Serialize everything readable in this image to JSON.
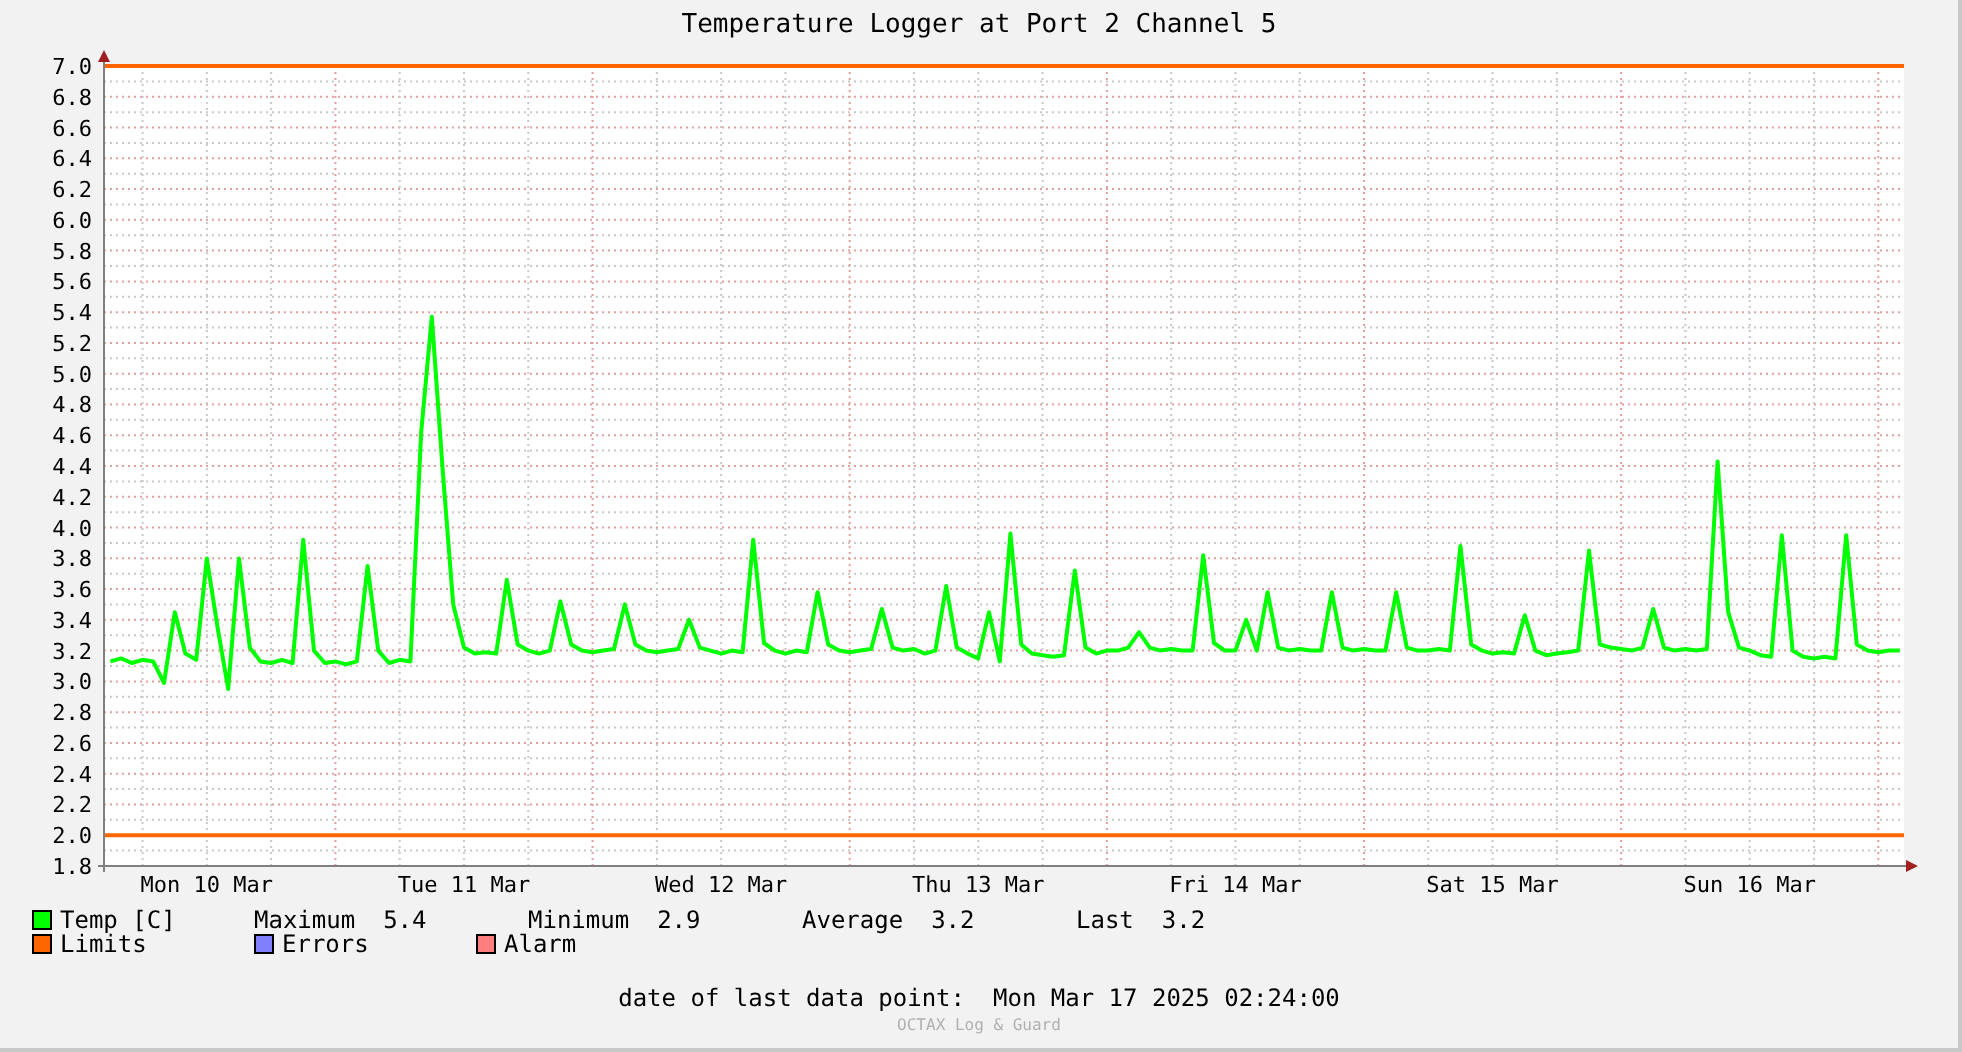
{
  "chart_data": {
    "type": "line",
    "title": "Temperature Logger at Port 2 Channel 5",
    "ylim": [
      1.8,
      7.0
    ],
    "yticks": [
      {
        "value": 1.8,
        "label": "1.8"
      },
      {
        "value": 2.0,
        "label": "2.0"
      },
      {
        "value": 2.2,
        "label": "2.2"
      },
      {
        "value": 2.4,
        "label": "2.4"
      },
      {
        "value": 2.6,
        "label": "2.6"
      },
      {
        "value": 2.8,
        "label": "2.8"
      },
      {
        "value": 3.0,
        "label": "3.0"
      },
      {
        "value": 3.2,
        "label": "3.2"
      },
      {
        "value": 3.4,
        "label": "3.4"
      },
      {
        "value": 3.6,
        "label": "3.6"
      },
      {
        "value": 3.8,
        "label": "3.8"
      },
      {
        "value": 4.0,
        "label": "4.0"
      },
      {
        "value": 4.2,
        "label": "4.2"
      },
      {
        "value": 4.4,
        "label": "4.4"
      },
      {
        "value": 4.6,
        "label": "4.6"
      },
      {
        "value": 4.8,
        "label": "4.8"
      },
      {
        "value": 5.0,
        "label": "5.0"
      },
      {
        "value": 5.2,
        "label": "5.2"
      },
      {
        "value": 5.4,
        "label": "5.4"
      },
      {
        "value": 5.6,
        "label": "5.6"
      },
      {
        "value": 5.8,
        "label": "5.8"
      },
      {
        "value": 6.0,
        "label": "6.0"
      },
      {
        "value": 6.2,
        "label": "6.2"
      },
      {
        "value": 6.4,
        "label": "6.4"
      },
      {
        "value": 6.6,
        "label": "6.6"
      },
      {
        "value": 6.8,
        "label": "6.8"
      },
      {
        "value": 7.0,
        "label": "7.0"
      }
    ],
    "categories": [
      null,
      null,
      null,
      null,
      null,
      null,
      null,
      null,
      null,
      "Mon 10 Mar",
      null,
      null,
      null,
      null,
      null,
      null,
      null,
      null,
      null,
      null,
      null,
      null,
      null,
      null,
      null,
      null,
      null,
      null,
      null,
      null,
      null,
      null,
      null,
      "Tue 11 Mar",
      null,
      null,
      null,
      null,
      null,
      null,
      null,
      null,
      null,
      null,
      null,
      null,
      null,
      null,
      null,
      null,
      null,
      null,
      null,
      null,
      null,
      null,
      null,
      "Wed 12 Mar",
      null,
      null,
      null,
      null,
      null,
      null,
      null,
      null,
      null,
      null,
      null,
      null,
      null,
      null,
      null,
      null,
      null,
      null,
      null,
      null,
      null,
      null,
      null,
      "Thu 13 Mar",
      null,
      null,
      null,
      null,
      null,
      null,
      null,
      null,
      null,
      null,
      null,
      null,
      null,
      null,
      null,
      null,
      null,
      null,
      null,
      null,
      null,
      null,
      null,
      "Fri 14 Mar",
      null,
      null,
      null,
      null,
      null,
      null,
      null,
      null,
      null,
      null,
      null,
      null,
      null,
      null,
      null,
      null,
      null,
      null,
      null,
      null,
      null,
      null,
      null,
      "Sat 15 Mar",
      null,
      null,
      null,
      null,
      null,
      null,
      null,
      null,
      null,
      null,
      null,
      null,
      null,
      null,
      null,
      null,
      null,
      null,
      null,
      null,
      null,
      null,
      null,
      "Sun 16 Mar",
      null,
      null,
      null,
      null,
      null,
      null,
      null,
      null,
      null,
      null,
      null,
      null,
      null,
      null
    ],
    "series": [
      {
        "name": "Temp [C]",
        "color": "#00ff00",
        "values": [
          3.13,
          3.15,
          3.12,
          3.14,
          3.13,
          2.99,
          3.45,
          3.18,
          3.14,
          3.8,
          3.35,
          2.95,
          3.8,
          3.22,
          3.13,
          3.12,
          3.14,
          3.12,
          3.92,
          3.2,
          3.12,
          3.13,
          3.11,
          3.13,
          3.75,
          3.2,
          3.12,
          3.14,
          3.13,
          4.62,
          5.37,
          4.38,
          3.5,
          3.22,
          3.18,
          3.19,
          3.18,
          3.66,
          3.24,
          3.2,
          3.18,
          3.2,
          3.52,
          3.24,
          3.2,
          3.19,
          3.2,
          3.21,
          3.5,
          3.24,
          3.2,
          3.19,
          3.2,
          3.21,
          3.4,
          3.22,
          3.2,
          3.18,
          3.2,
          3.19,
          3.92,
          3.25,
          3.2,
          3.18,
          3.2,
          3.19,
          3.58,
          3.24,
          3.2,
          3.19,
          3.2,
          3.21,
          3.47,
          3.22,
          3.2,
          3.21,
          3.18,
          3.2,
          3.62,
          3.22,
          3.18,
          3.15,
          3.45,
          3.13,
          3.96,
          3.24,
          3.18,
          3.17,
          3.16,
          3.17,
          3.72,
          3.22,
          3.18,
          3.2,
          3.2,
          3.22,
          3.32,
          3.22,
          3.2,
          3.21,
          3.2,
          3.2,
          3.82,
          3.25,
          3.2,
          3.2,
          3.4,
          3.2,
          3.58,
          3.22,
          3.2,
          3.21,
          3.2,
          3.2,
          3.58,
          3.22,
          3.2,
          3.21,
          3.2,
          3.2,
          3.58,
          3.22,
          3.2,
          3.2,
          3.21,
          3.2,
          3.88,
          3.24,
          3.2,
          3.18,
          3.19,
          3.18,
          3.43,
          3.2,
          3.17,
          3.18,
          3.19,
          3.2,
          3.85,
          3.24,
          3.22,
          3.21,
          3.2,
          3.22,
          3.47,
          3.22,
          3.2,
          3.21,
          3.2,
          3.21,
          4.43,
          3.45,
          3.22,
          3.2,
          3.17,
          3.16,
          3.95,
          3.2,
          3.16,
          3.15,
          3.16,
          3.15,
          3.95,
          3.24,
          3.2,
          3.19,
          3.2,
          3.2
        ]
      }
    ],
    "grid": true,
    "ref_lines": [
      {
        "axis": "y",
        "value": 7.0,
        "color": "#ff6600"
      },
      {
        "axis": "y",
        "value": 2.0,
        "color": "#ff6600"
      }
    ]
  },
  "legend": [
    {
      "stats": [
        {
          "label": "Maximum",
          "value": "5.4"
        },
        {
          "label": "Minimum",
          "value": "2.9"
        },
        {
          "label": "Average",
          "value": "3.2"
        },
        {
          "label": "Last",
          "value": "3.2"
        }
      ]
    },
    {
      "entries": [
        {
          "label": "Limits",
          "color": "#ff6600"
        },
        {
          "label": "Errors",
          "color": "#7f7fff"
        },
        {
          "label": "Alarm",
          "color": "#ff7f7f"
        }
      ]
    }
  ],
  "footer": {
    "label": "date of last data point:",
    "value": "Mon Mar 17 2025 02:24:00",
    "credit": "OCTAX Log & Guard"
  }
}
